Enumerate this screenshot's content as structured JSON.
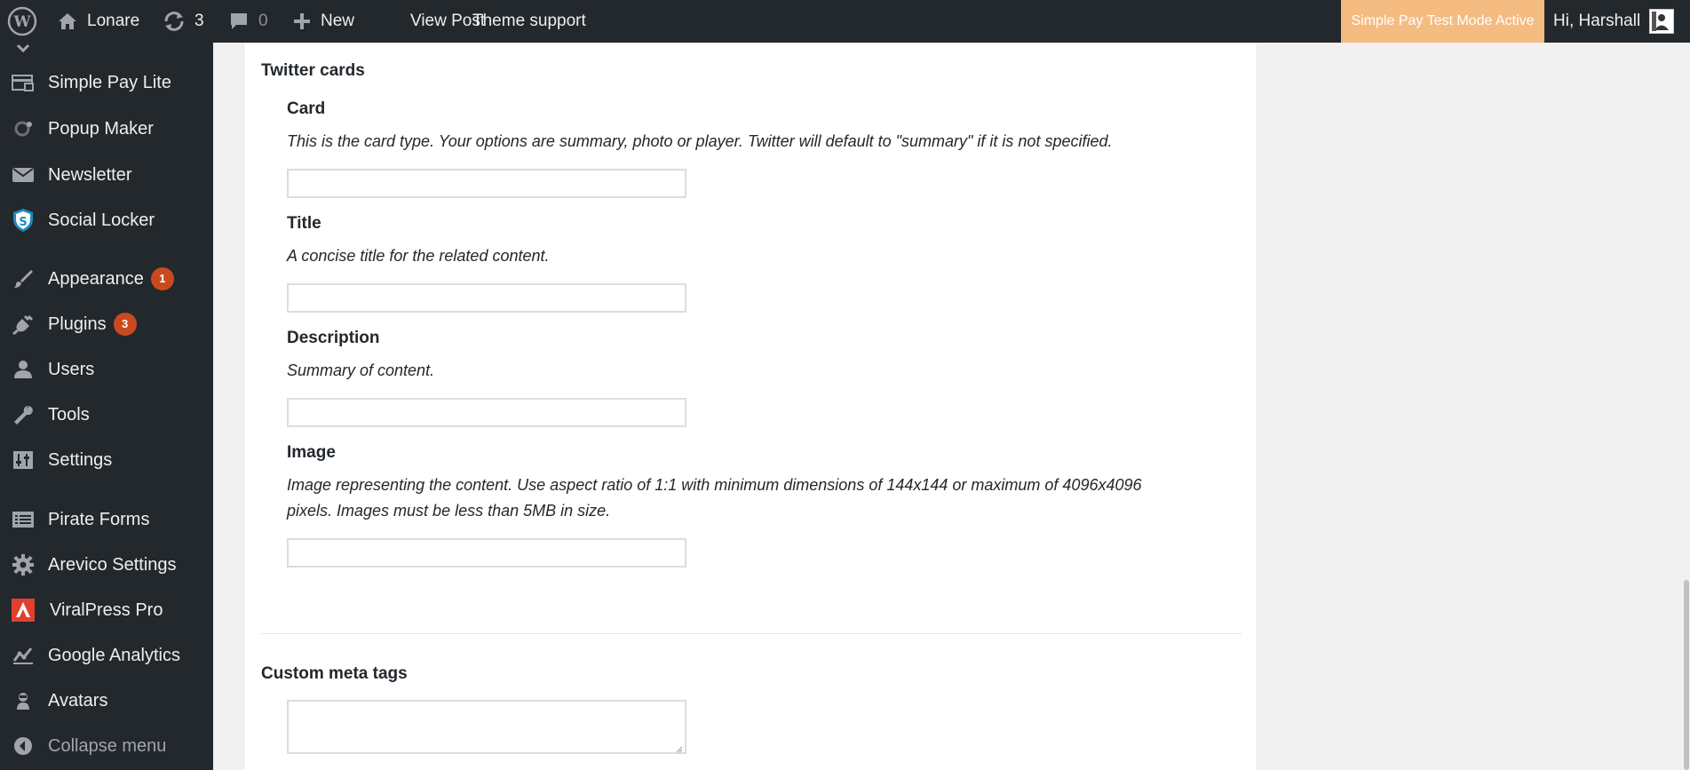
{
  "admin_bar": {
    "site_name": "Lonare",
    "updates_count": "3",
    "comments_count": "0",
    "new_label": "New",
    "view_post_label": "View Post",
    "theme_support_label": "Theme support",
    "test_mode_label": "Simple Pay Test Mode Active",
    "greeting": "Hi, Harshall"
  },
  "sidebar": {
    "items": [
      {
        "label": "Simple Pay Lite",
        "icon": "simple-pay-icon"
      },
      {
        "label": "Popup Maker",
        "icon": "popup-maker-icon"
      },
      {
        "label": "Newsletter",
        "icon": "envelope-icon"
      },
      {
        "label": "Social Locker",
        "icon": "shield-icon"
      },
      {
        "label": "Appearance",
        "icon": "paintbrush-icon",
        "badge": "1"
      },
      {
        "label": "Plugins",
        "icon": "plug-icon",
        "badge": "3"
      },
      {
        "label": "Users",
        "icon": "user-icon"
      },
      {
        "label": "Tools",
        "icon": "wrench-icon"
      },
      {
        "label": "Settings",
        "icon": "settings-sliders-icon"
      },
      {
        "label": "Pirate Forms",
        "icon": "form-icon"
      },
      {
        "label": "Arevico Settings",
        "icon": "gear-icon"
      },
      {
        "label": "ViralPress Pro",
        "icon": "viralpress-icon"
      },
      {
        "label": "Google Analytics",
        "icon": "analytics-icon"
      },
      {
        "label": "Avatars",
        "icon": "avatar-icon"
      },
      {
        "label": "Collapse menu",
        "icon": "collapse-icon"
      }
    ]
  },
  "content": {
    "twitter_cards_title": "Twitter cards",
    "fields": [
      {
        "label": "Card",
        "description": "This is the card type. Your options are summary, photo or player. Twitter will default to \"summary\" if it is not specified.",
        "value": ""
      },
      {
        "label": "Title",
        "description": "A concise title for the related content.",
        "value": ""
      },
      {
        "label": "Description",
        "description": "Summary of content.",
        "value": ""
      },
      {
        "label": "Image",
        "description": "Image representing the content. Use aspect ratio of 1:1 with minimum dimensions of 144x144 or maximum of 4096x4096",
        "description_line2": "pixels. Images must be less than 5MB in size.",
        "value": ""
      }
    ],
    "custom_meta_title": "Custom meta tags",
    "custom_meta_value": ""
  },
  "colors": {
    "admin_bar_bg": "#23282d",
    "test_mode_bg": "#f5bc82",
    "badge_bg": "#ca4a1f"
  }
}
